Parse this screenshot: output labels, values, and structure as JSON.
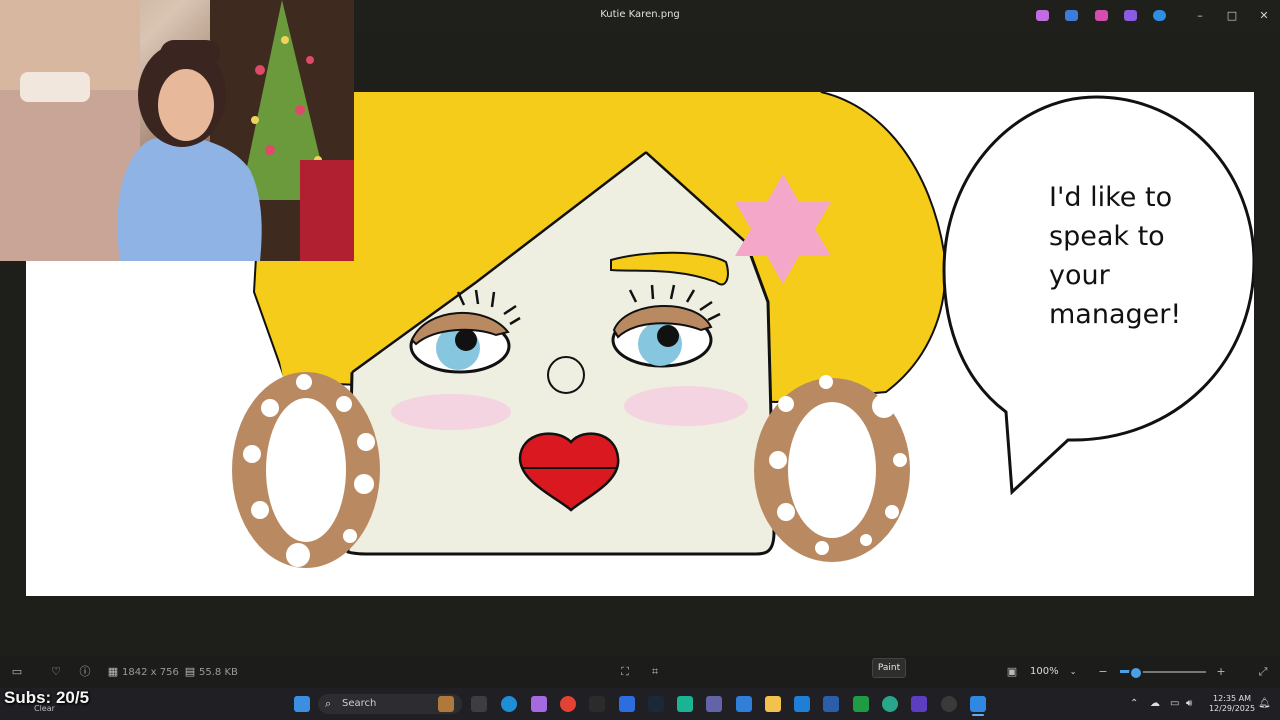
{
  "window": {
    "title": "Kutie Karen.png",
    "minimize_label": "–",
    "maximize_label": "□",
    "close_label": "✕"
  },
  "drawing": {
    "speech_lines": [
      "I'd like to",
      "speak to",
      "your",
      "manager!"
    ],
    "colors": {
      "hair": "#f5cc1a",
      "skin": "#eeefe0",
      "earring": "#b98a62",
      "lips": "#d9191f",
      "eyes": "#86c7df",
      "star": "#f4a7c9",
      "blush": "#f6cfe1"
    }
  },
  "bottombar": {
    "dimensions": "1842 x 756",
    "file_size": "55.8 KB",
    "tooltip": "Paint",
    "zoom_value": "100%",
    "zoom_percent": 0.15
  },
  "taskbar": {
    "search_placeholder": "Search",
    "weather": "Clear",
    "time": "12:35 AM",
    "date": "12/29/2025",
    "subs_text": "Subs: 20/5"
  },
  "icons": {
    "filmstrip": "filmstrip-icon",
    "favorite": "heart-icon",
    "info": "info-icon",
    "fit": "fit-to-window-icon",
    "expand": "fullscreen-icon",
    "zoom_in": "zoom-in-icon",
    "zoom_out": "zoom-out-icon"
  }
}
